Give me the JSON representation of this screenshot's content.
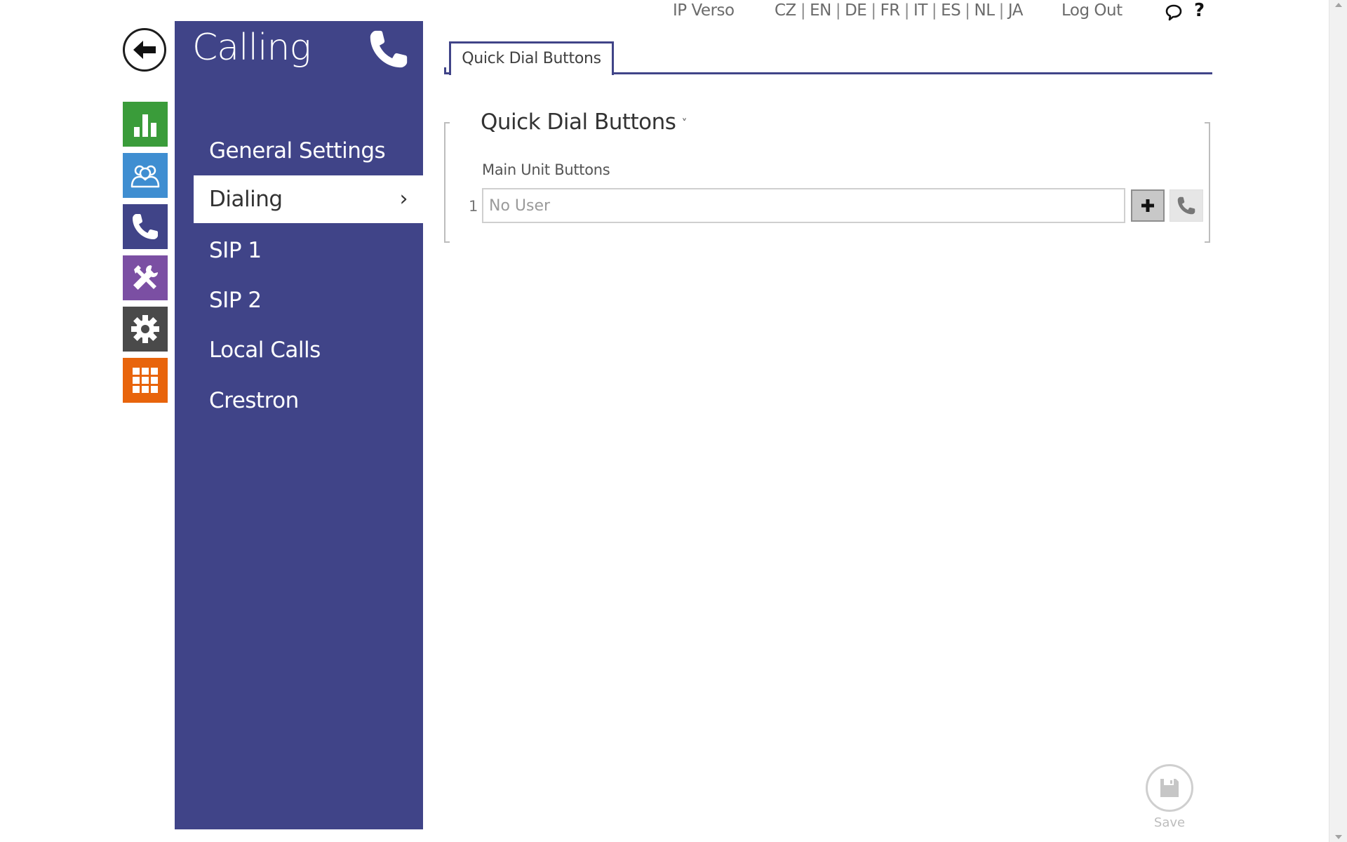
{
  "header": {
    "product": "IP Verso",
    "languages": [
      "CZ",
      "EN",
      "DE",
      "FR",
      "IT",
      "ES",
      "NL",
      "JA"
    ],
    "logout_label": "Log Out",
    "chat_icon": "speech-bubble-icon",
    "help_label": "?"
  },
  "rail": {
    "back_icon": "arrow-left-icon",
    "tiles": [
      {
        "name": "status",
        "icon": "bar-chart-icon",
        "color": "#3a9c3a"
      },
      {
        "name": "directory",
        "icon": "users-icon",
        "color": "#3f8ed1"
      },
      {
        "name": "calling",
        "icon": "phone-icon",
        "color": "#404488"
      },
      {
        "name": "hardware",
        "icon": "tools-icon",
        "color": "#7b4fa3"
      },
      {
        "name": "system",
        "icon": "gear-icon",
        "color": "#4a4a4a"
      },
      {
        "name": "services",
        "icon": "grid-icon",
        "color": "#e8640c"
      }
    ]
  },
  "menu": {
    "title": "Calling",
    "title_icon": "phone-icon",
    "items": [
      {
        "label": "General Settings",
        "active": false
      },
      {
        "label": "Dialing",
        "active": true
      },
      {
        "label": "SIP 1",
        "active": false
      },
      {
        "label": "SIP 2",
        "active": false
      },
      {
        "label": "Local Calls",
        "active": false
      },
      {
        "label": "Crestron",
        "active": false
      }
    ],
    "active_chevron": "›"
  },
  "tabs": [
    {
      "label": "Quick Dial Buttons",
      "active": true
    }
  ],
  "section": {
    "title": "Quick Dial Buttons",
    "caret": "˅",
    "field_label": "Main Unit Buttons",
    "rows": [
      {
        "number": "1",
        "value": "",
        "placeholder": "No User"
      }
    ]
  },
  "save": {
    "label": "Save",
    "icon": "floppy-disk-icon"
  },
  "colors": {
    "menu_bg": "#404488",
    "accent": "#404488"
  }
}
